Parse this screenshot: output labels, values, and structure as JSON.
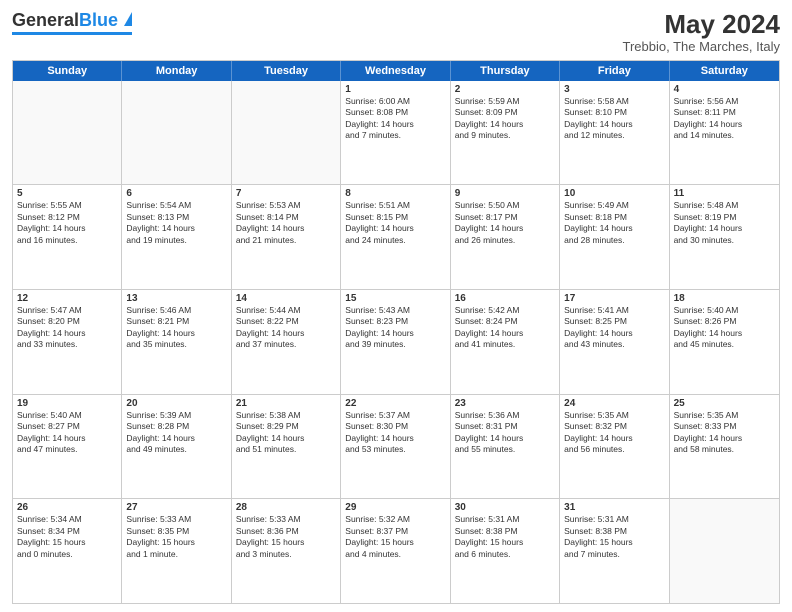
{
  "header": {
    "logo_general": "General",
    "logo_blue": "Blue",
    "month_title": "May 2024",
    "subtitle": "Trebbio, The Marches, Italy"
  },
  "days_of_week": [
    "Sunday",
    "Monday",
    "Tuesday",
    "Wednesday",
    "Thursday",
    "Friday",
    "Saturday"
  ],
  "weeks": [
    [
      {
        "day": "",
        "lines": []
      },
      {
        "day": "",
        "lines": []
      },
      {
        "day": "",
        "lines": []
      },
      {
        "day": "1",
        "lines": [
          "Sunrise: 6:00 AM",
          "Sunset: 8:08 PM",
          "Daylight: 14 hours",
          "and 7 minutes."
        ]
      },
      {
        "day": "2",
        "lines": [
          "Sunrise: 5:59 AM",
          "Sunset: 8:09 PM",
          "Daylight: 14 hours",
          "and 9 minutes."
        ]
      },
      {
        "day": "3",
        "lines": [
          "Sunrise: 5:58 AM",
          "Sunset: 8:10 PM",
          "Daylight: 14 hours",
          "and 12 minutes."
        ]
      },
      {
        "day": "4",
        "lines": [
          "Sunrise: 5:56 AM",
          "Sunset: 8:11 PM",
          "Daylight: 14 hours",
          "and 14 minutes."
        ]
      }
    ],
    [
      {
        "day": "5",
        "lines": [
          "Sunrise: 5:55 AM",
          "Sunset: 8:12 PM",
          "Daylight: 14 hours",
          "and 16 minutes."
        ]
      },
      {
        "day": "6",
        "lines": [
          "Sunrise: 5:54 AM",
          "Sunset: 8:13 PM",
          "Daylight: 14 hours",
          "and 19 minutes."
        ]
      },
      {
        "day": "7",
        "lines": [
          "Sunrise: 5:53 AM",
          "Sunset: 8:14 PM",
          "Daylight: 14 hours",
          "and 21 minutes."
        ]
      },
      {
        "day": "8",
        "lines": [
          "Sunrise: 5:51 AM",
          "Sunset: 8:15 PM",
          "Daylight: 14 hours",
          "and 24 minutes."
        ]
      },
      {
        "day": "9",
        "lines": [
          "Sunrise: 5:50 AM",
          "Sunset: 8:17 PM",
          "Daylight: 14 hours",
          "and 26 minutes."
        ]
      },
      {
        "day": "10",
        "lines": [
          "Sunrise: 5:49 AM",
          "Sunset: 8:18 PM",
          "Daylight: 14 hours",
          "and 28 minutes."
        ]
      },
      {
        "day": "11",
        "lines": [
          "Sunrise: 5:48 AM",
          "Sunset: 8:19 PM",
          "Daylight: 14 hours",
          "and 30 minutes."
        ]
      }
    ],
    [
      {
        "day": "12",
        "lines": [
          "Sunrise: 5:47 AM",
          "Sunset: 8:20 PM",
          "Daylight: 14 hours",
          "and 33 minutes."
        ]
      },
      {
        "day": "13",
        "lines": [
          "Sunrise: 5:46 AM",
          "Sunset: 8:21 PM",
          "Daylight: 14 hours",
          "and 35 minutes."
        ]
      },
      {
        "day": "14",
        "lines": [
          "Sunrise: 5:44 AM",
          "Sunset: 8:22 PM",
          "Daylight: 14 hours",
          "and 37 minutes."
        ]
      },
      {
        "day": "15",
        "lines": [
          "Sunrise: 5:43 AM",
          "Sunset: 8:23 PM",
          "Daylight: 14 hours",
          "and 39 minutes."
        ]
      },
      {
        "day": "16",
        "lines": [
          "Sunrise: 5:42 AM",
          "Sunset: 8:24 PM",
          "Daylight: 14 hours",
          "and 41 minutes."
        ]
      },
      {
        "day": "17",
        "lines": [
          "Sunrise: 5:41 AM",
          "Sunset: 8:25 PM",
          "Daylight: 14 hours",
          "and 43 minutes."
        ]
      },
      {
        "day": "18",
        "lines": [
          "Sunrise: 5:40 AM",
          "Sunset: 8:26 PM",
          "Daylight: 14 hours",
          "and 45 minutes."
        ]
      }
    ],
    [
      {
        "day": "19",
        "lines": [
          "Sunrise: 5:40 AM",
          "Sunset: 8:27 PM",
          "Daylight: 14 hours",
          "and 47 minutes."
        ]
      },
      {
        "day": "20",
        "lines": [
          "Sunrise: 5:39 AM",
          "Sunset: 8:28 PM",
          "Daylight: 14 hours",
          "and 49 minutes."
        ]
      },
      {
        "day": "21",
        "lines": [
          "Sunrise: 5:38 AM",
          "Sunset: 8:29 PM",
          "Daylight: 14 hours",
          "and 51 minutes."
        ]
      },
      {
        "day": "22",
        "lines": [
          "Sunrise: 5:37 AM",
          "Sunset: 8:30 PM",
          "Daylight: 14 hours",
          "and 53 minutes."
        ]
      },
      {
        "day": "23",
        "lines": [
          "Sunrise: 5:36 AM",
          "Sunset: 8:31 PM",
          "Daylight: 14 hours",
          "and 55 minutes."
        ]
      },
      {
        "day": "24",
        "lines": [
          "Sunrise: 5:35 AM",
          "Sunset: 8:32 PM",
          "Daylight: 14 hours",
          "and 56 minutes."
        ]
      },
      {
        "day": "25",
        "lines": [
          "Sunrise: 5:35 AM",
          "Sunset: 8:33 PM",
          "Daylight: 14 hours",
          "and 58 minutes."
        ]
      }
    ],
    [
      {
        "day": "26",
        "lines": [
          "Sunrise: 5:34 AM",
          "Sunset: 8:34 PM",
          "Daylight: 15 hours",
          "and 0 minutes."
        ]
      },
      {
        "day": "27",
        "lines": [
          "Sunrise: 5:33 AM",
          "Sunset: 8:35 PM",
          "Daylight: 15 hours",
          "and 1 minute."
        ]
      },
      {
        "day": "28",
        "lines": [
          "Sunrise: 5:33 AM",
          "Sunset: 8:36 PM",
          "Daylight: 15 hours",
          "and 3 minutes."
        ]
      },
      {
        "day": "29",
        "lines": [
          "Sunrise: 5:32 AM",
          "Sunset: 8:37 PM",
          "Daylight: 15 hours",
          "and 4 minutes."
        ]
      },
      {
        "day": "30",
        "lines": [
          "Sunrise: 5:31 AM",
          "Sunset: 8:38 PM",
          "Daylight: 15 hours",
          "and 6 minutes."
        ]
      },
      {
        "day": "31",
        "lines": [
          "Sunrise: 5:31 AM",
          "Sunset: 8:38 PM",
          "Daylight: 15 hours",
          "and 7 minutes."
        ]
      },
      {
        "day": "",
        "lines": []
      }
    ]
  ]
}
